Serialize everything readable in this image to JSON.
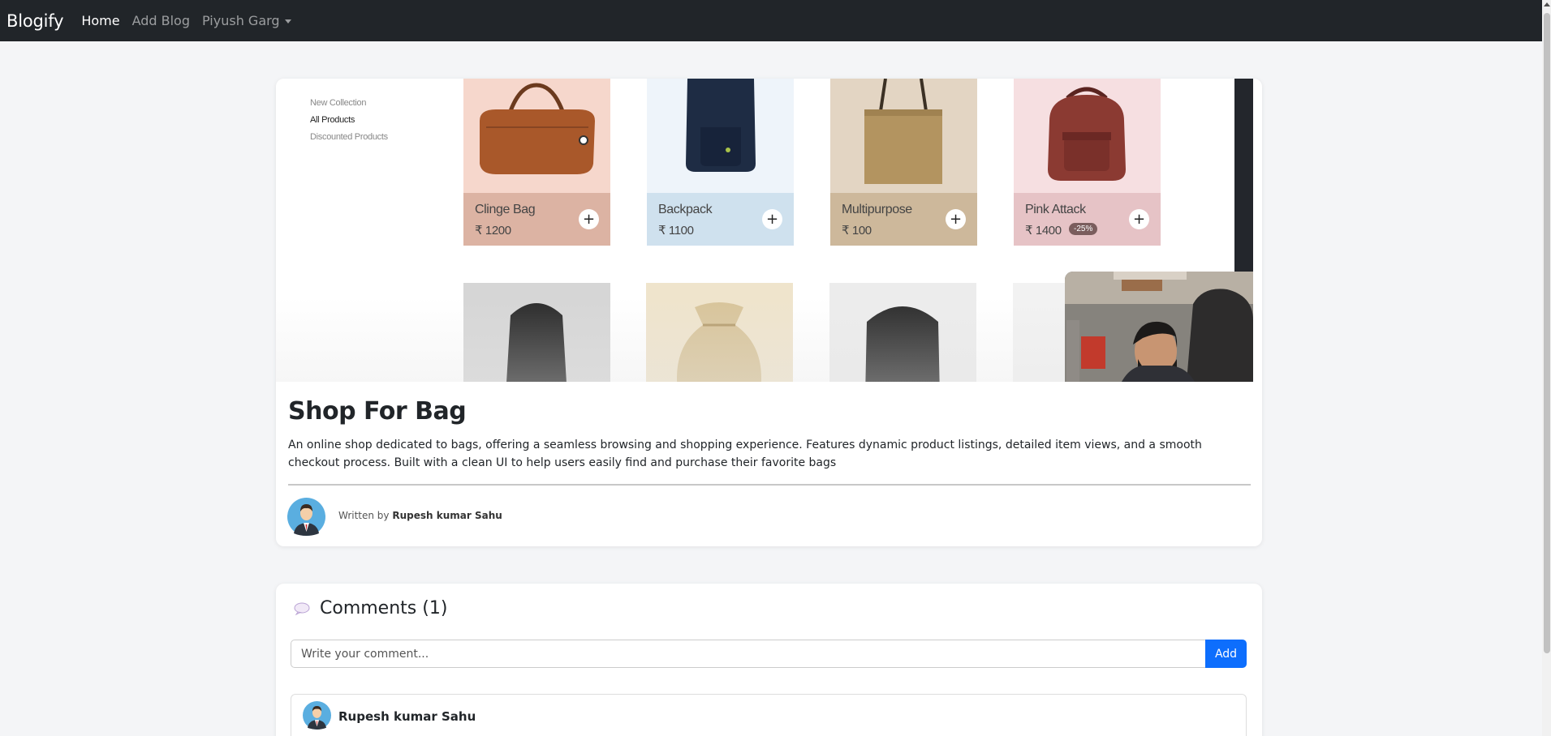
{
  "navbar": {
    "brand": "Blogify",
    "links": [
      "Home",
      "Add Blog"
    ],
    "user": "Piyush Garg"
  },
  "hero": {
    "menu": [
      "New Collection",
      "All Products",
      "Discounted Products"
    ],
    "products": [
      {
        "name": "Clinge Bag",
        "price": "₹ 1200",
        "badge": ""
      },
      {
        "name": "Backpack",
        "price": "₹ 1100",
        "badge": ""
      },
      {
        "name": "Multipurpose",
        "price": "₹ 100",
        "badge": ""
      },
      {
        "name": "Pink Attack",
        "price": "₹ 1400",
        "badge": "-25%"
      }
    ],
    "add_symbol": "+"
  },
  "blog": {
    "title": "Shop For Bag",
    "description": "An online shop dedicated to bags, offering a seamless browsing and shopping experience. Features dynamic product listings, detailed item views, and a smooth checkout process. Built with a clean UI to help users easily find and purchase their favorite bags",
    "written_by_label": "Written by",
    "author": "Rupesh kumar Sahu"
  },
  "comments": {
    "heading": "Comments (1)",
    "placeholder": "Write your comment...",
    "add_label": "Add",
    "items": [
      {
        "author": "Rupesh kumar Sahu"
      }
    ]
  }
}
